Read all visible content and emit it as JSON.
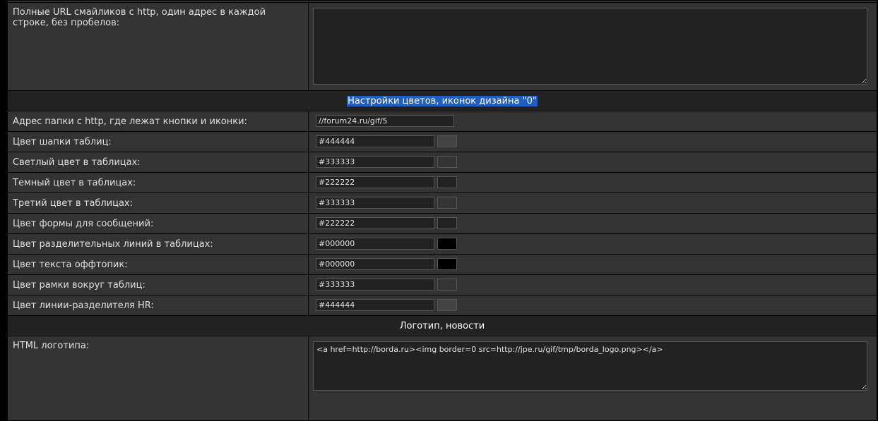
{
  "smiley_urls": {
    "label": "Полные URL смайликов с http, один адрес в каждой строке, без пробелов:",
    "value": ""
  },
  "colors_section": {
    "title": "Настройки цветов, иконок дизайна \"0\"",
    "folder": {
      "label": "Адрес папки с http, где лежат кнопки и иконки:",
      "value": "//forum24.ru/gif/5"
    },
    "rows": [
      {
        "label": "Цвет шапки таблиц:",
        "value": "#444444",
        "swatch": "#444444"
      },
      {
        "label": "Светлый цвет в таблицах:",
        "value": "#333333",
        "swatch": "#333333"
      },
      {
        "label": "Темный цвет в таблицах:",
        "value": "#222222",
        "swatch": "#222222"
      },
      {
        "label": "Третий цвет в таблицах:",
        "value": "#333333",
        "swatch": "#333333"
      },
      {
        "label": "Цвет формы для сообщений:",
        "value": "#222222",
        "swatch": "#222222"
      },
      {
        "label": "Цвет разделительных линий в таблицах:",
        "value": "#000000",
        "swatch": "#000000"
      },
      {
        "label": "Цвет текста оффтопик:",
        "value": "#000000",
        "swatch": "#000000"
      },
      {
        "label": "Цвет рамки вокруг таблиц:",
        "value": "#333333",
        "swatch": "#333333"
      },
      {
        "label": "Цвет линии-разделителя HR:",
        "value": "#444444",
        "swatch": "#444444"
      }
    ]
  },
  "logo_section": {
    "title": "Логотип, новости",
    "html_logo": {
      "label": "HTML логотипа:",
      "value": "<a href=http://borda.ru><img border=0 src=http://jpe.ru/gif/tmp/borda_logo.png></a>"
    }
  }
}
